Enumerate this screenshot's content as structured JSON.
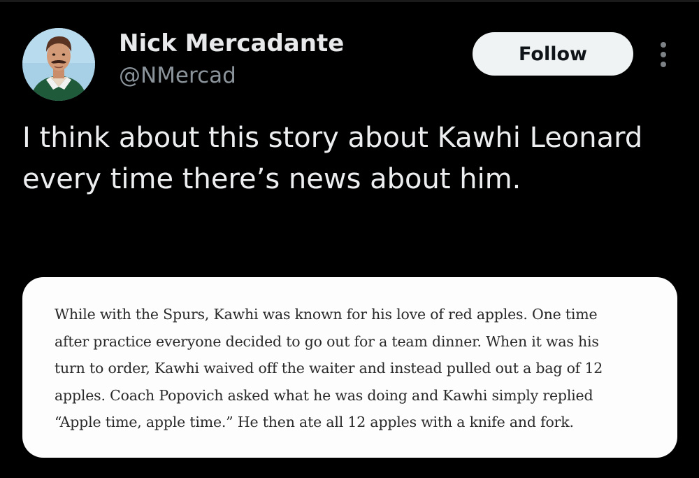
{
  "tweet": {
    "author": {
      "display_name": "Nick Mercadante",
      "handle": "@NMercad",
      "avatar_icon": "profile-photo"
    },
    "follow_label": "Follow",
    "more_icon": "more-options-vertical-icon",
    "text": "I think about this story about Kawhi Leonard every time there’s news about him.",
    "quote_image": {
      "lines": [
        "While with the Spurs, Kawhi was known for his love of red apples. One time",
        "after practice everyone decided to go out for a team dinner. When it was his",
        "turn to order, Kawhi waived off the waiter and instead pulled out a bag of 12",
        "apples. Coach Popovich asked what he was doing and Kawhi simply replied",
        "“Apple time, apple time.” He then ate all 12 apples with a knife and fork."
      ]
    }
  },
  "colors": {
    "background": "#000000",
    "primary_text": "#e7e9ea",
    "secondary_text": "#8b949b",
    "follow_button_bg": "#eff3f4",
    "follow_button_text": "#0f1419",
    "card_bg": "#fdfdfd",
    "card_text": "#2a2a2a"
  }
}
